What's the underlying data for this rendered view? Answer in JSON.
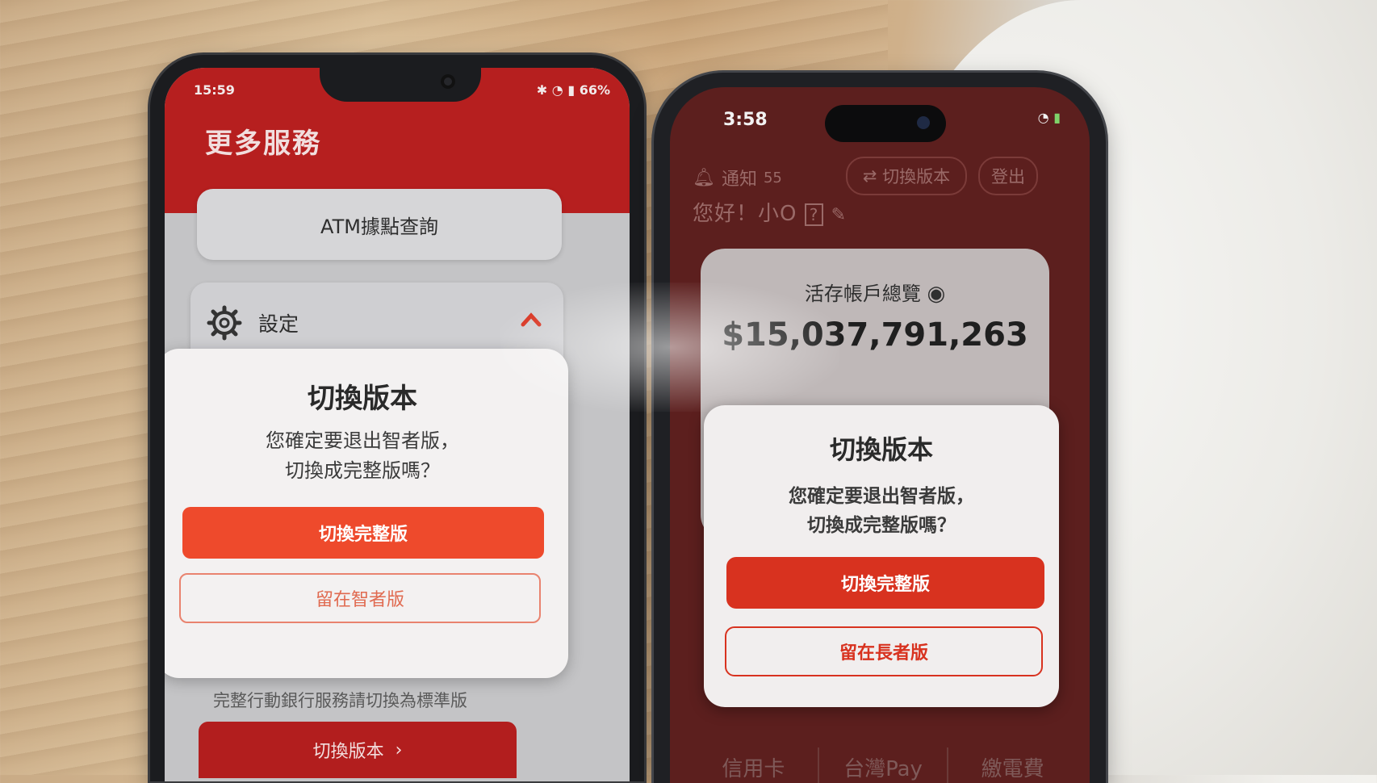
{
  "phone_a": {
    "status": {
      "time": "15:59",
      "battery": "66%"
    },
    "page_title": "更多服務",
    "atm_card": "ATM據點查詢",
    "settings_label": "設定",
    "background_note": "完整行動銀行服務請切換為標準版",
    "background_button": "切換版本",
    "dialog": {
      "title": "切換版本",
      "message_line1": "您確定要退出智者版，",
      "message_line2": "切換成完整版嗎？",
      "primary_button": "切換完整版",
      "secondary_button": "留在智者版"
    }
  },
  "phone_b": {
    "status": {
      "time": "3:58"
    },
    "notification_label": "通知",
    "notification_count": "55",
    "switch_version_pill": "切換版本",
    "logout_pill": "登出",
    "greeting": "您好！小O",
    "account_overview": "活存帳戶總覽",
    "balance": "$15,037,791,263",
    "dialog": {
      "title": "切換版本",
      "message_line1": "您確定要退出智者版，",
      "message_line2": "切換成完整版嗎？",
      "primary_button": "切換完整版",
      "secondary_button": "留在長者版"
    },
    "bottom_tabs": [
      "信用卡",
      "台灣Pay",
      "繳電費"
    ]
  },
  "colors": {
    "bank_red": "#b61f1f",
    "primary_orange": "#ee4a2c",
    "primary_red": "#d8321f"
  }
}
